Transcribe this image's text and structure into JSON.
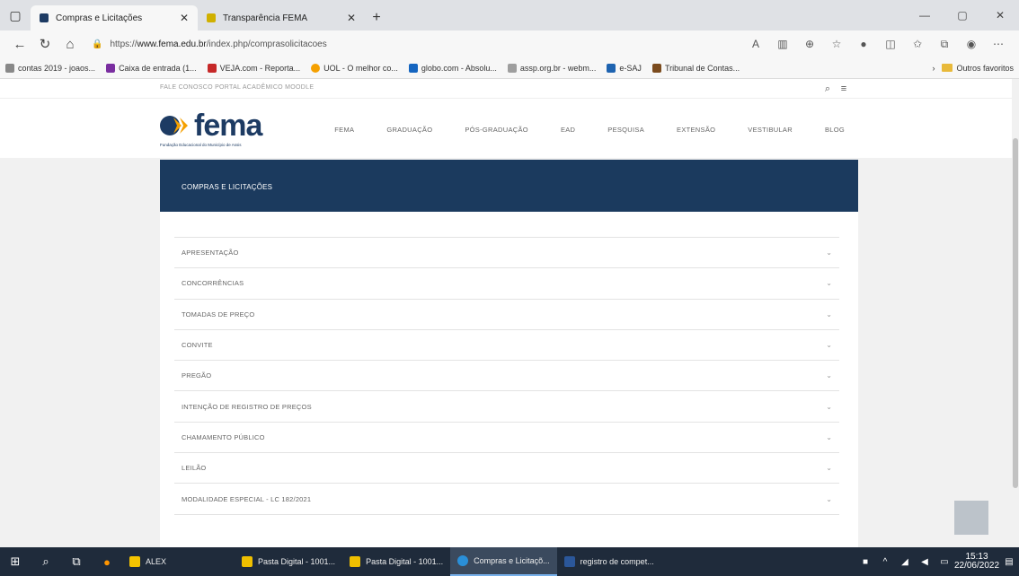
{
  "browser": {
    "tabs": [
      {
        "label": "Compras e Licitações",
        "favicon_color": "#1d3b63",
        "active": true
      },
      {
        "label": "Transparência FEMA",
        "favicon_color": "#d0b000",
        "active": false
      }
    ],
    "url_prefix": "https://",
    "url_host": "www.fema.edu.br",
    "url_path": "/index.php/comprasolicitacoes",
    "favorites": [
      {
        "label": "contas 2019 - joaos...",
        "color": "#888888"
      },
      {
        "label": "Caixa de entrada (1...",
        "color": "#7a2ea0"
      },
      {
        "label": "VEJA.com - Reporta...",
        "color": "#c62828"
      },
      {
        "label": "UOL - O melhor co...",
        "color": "#f5a000"
      },
      {
        "label": "globo.com - Absolu...",
        "color": "#1565c0"
      },
      {
        "label": "assp.org.br - webm...",
        "color": "#9e9e9e"
      },
      {
        "label": "e-SAJ",
        "color": "#1e63b0"
      },
      {
        "label": "Tribunal de Contas...",
        "color": "#7b4b1e"
      }
    ],
    "other_favorites": "Outros favoritos"
  },
  "site": {
    "portal_link": "FALE CONOSCO   PORTAL ACADÊMICO   MOODLE",
    "logo_text": "fema",
    "logo_subtitle": "Fundação Educacional do Município de Assis",
    "nav": [
      "FEMA",
      "GRADUAÇÃO",
      "PÓS-GRADUAÇÃO",
      "EAD",
      "PESQUISA",
      "EXTENSÃO",
      "VESTIBULAR",
      "BLOG"
    ],
    "brand_color": "#1b3a5e",
    "accent_color": "#f5a000"
  },
  "page": {
    "banner_title": "COMPRAS E LICITAÇÕES",
    "accordion": [
      "APRESENTAÇÃO",
      "CONCORRÊNCIAS",
      "TOMADAS DE PREÇO",
      "CONVITE",
      "PREGÃO",
      "INTENÇÃO DE REGISTRO DE PREÇOS",
      "CHAMAMENTO PÚBLICO",
      "LEILÃO",
      "MODALIDADE ESPECIAL - LC 182/2021"
    ]
  },
  "taskbar": {
    "apps": [
      {
        "label": "ALEX",
        "color": "#f5c400",
        "active": false
      },
      {
        "label": "Pasta Digital - 1001...",
        "color": "#f0c000",
        "active": false
      },
      {
        "label": "Pasta Digital - 1001...",
        "color": "#f0c000",
        "active": false
      },
      {
        "label": "Compras e Licitaçõ...",
        "color": "#2a8fd8",
        "active": true
      },
      {
        "label": "registro de compet...",
        "color": "#2b579a",
        "active": false
      }
    ],
    "time": "15:13",
    "date": "22/06/2022"
  }
}
